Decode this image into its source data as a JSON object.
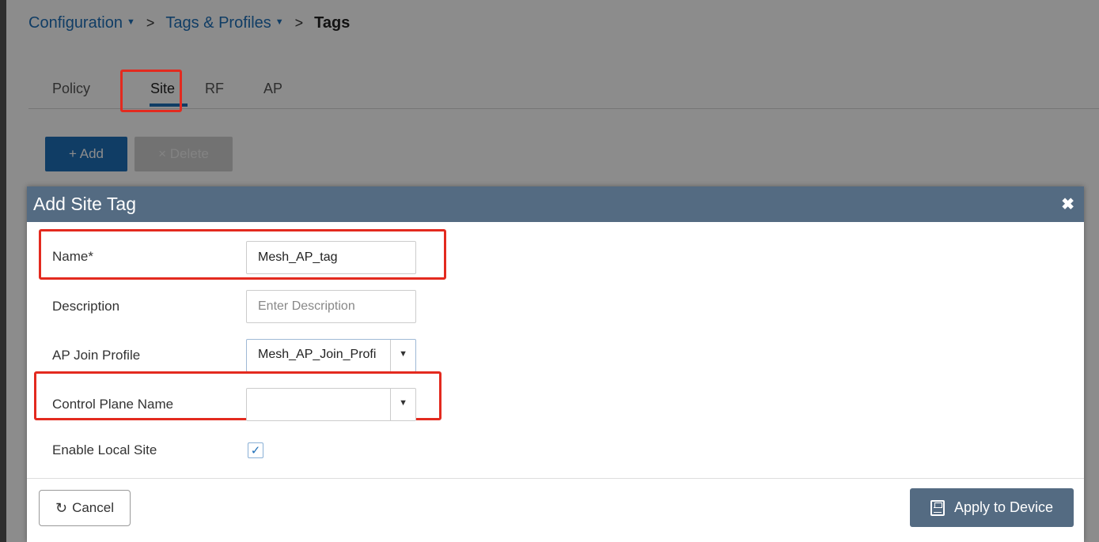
{
  "breadcrumb": {
    "items": [
      "Configuration",
      "Tags & Profiles"
    ],
    "separator": ">",
    "current": "Tags"
  },
  "tabs": [
    "Policy",
    "Site",
    "RF",
    "AP"
  ],
  "active_tab": "Site",
  "toolbar": {
    "add_label": "+ Add",
    "delete_label": "× Delete"
  },
  "modal": {
    "title": "Add Site Tag",
    "close_icon": "close-icon",
    "fields": {
      "name": {
        "label": "Name*",
        "value": "Mesh_AP_tag"
      },
      "description": {
        "label": "Description",
        "placeholder": "Enter Description",
        "value": ""
      },
      "ap_join_profile": {
        "label": "AP Join Profile",
        "value": "Mesh_AP_Join_Profi"
      },
      "control_plane_name": {
        "label": "Control Plane Name",
        "value": ""
      },
      "enable_local_site": {
        "label": "Enable Local Site",
        "checked": true,
        "check_glyph": "✓"
      }
    },
    "cancel_label": "Cancel",
    "cancel_icon": "↻",
    "apply_label": "Apply to Device"
  },
  "colors": {
    "accent": "#1e6fb8",
    "header": "#546b82",
    "highlight": "#e32a1f"
  }
}
